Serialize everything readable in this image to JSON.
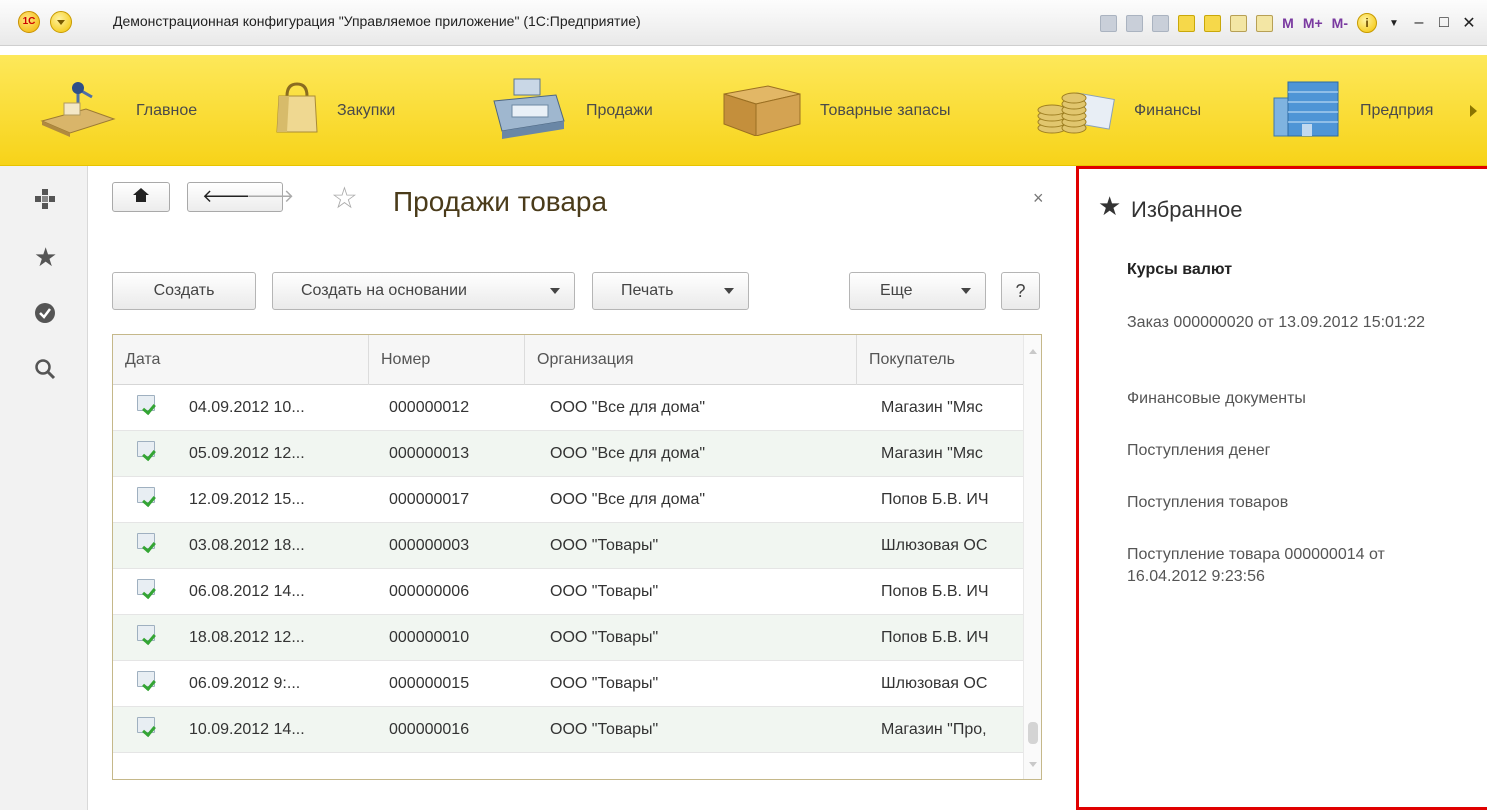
{
  "window": {
    "title": "Демонстрационная конфигурация \"Управляемое приложение\" (1С:Предприятие)",
    "logo_text": "1С",
    "memory_buttons": [
      "M",
      "M+",
      "M-"
    ],
    "info_label": "i",
    "minimize": "–",
    "maximize": "□",
    "close": "✕"
  },
  "sections": [
    {
      "label": "Главное",
      "icon": "desk-lamp-icon"
    },
    {
      "label": "Закупки",
      "icon": "shopping-bag-icon"
    },
    {
      "label": "Продажи",
      "icon": "cash-register-icon"
    },
    {
      "label": "Товарные запасы",
      "icon": "cardboard-box-icon"
    },
    {
      "label": "Финансы",
      "icon": "coins-icon"
    },
    {
      "label": "Предприя",
      "icon": "office-building-icon"
    }
  ],
  "left_panel": [
    "functions-icon",
    "star-icon",
    "history-icon",
    "search-icon"
  ],
  "form": {
    "title": "Продажи товара",
    "close": "×",
    "buttons": {
      "create": "Создать",
      "create_based": "Создать на основании",
      "print": "Печать",
      "more": "Еще",
      "help": "?"
    }
  },
  "table": {
    "columns": [
      "Дата",
      "Номер",
      "Организация",
      "Покупатель"
    ],
    "rows": [
      {
        "date": "04.09.2012 10...",
        "number": "000000012",
        "org": "ООО \"Все для дома\"",
        "buyer": "Магазин \"Мяс"
      },
      {
        "date": "05.09.2012 12...",
        "number": "000000013",
        "org": "ООО \"Все для дома\"",
        "buyer": "Магазин \"Мяс"
      },
      {
        "date": "12.09.2012 15...",
        "number": "000000017",
        "org": "ООО \"Все для дома\"",
        "buyer": "Попов Б.В. ИЧ"
      },
      {
        "date": "03.08.2012 18...",
        "number": "000000003",
        "org": "ООО \"Товары\"",
        "buyer": "Шлюзовая ОС"
      },
      {
        "date": "06.08.2012 14...",
        "number": "000000006",
        "org": "ООО \"Товары\"",
        "buyer": "Попов Б.В. ИЧ"
      },
      {
        "date": "18.08.2012 12...",
        "number": "000000010",
        "org": "ООО \"Товары\"",
        "buyer": "Попов Б.В. ИЧ"
      },
      {
        "date": "06.09.2012 9:...",
        "number": "000000015",
        "org": "ООО \"Товары\"",
        "buyer": "Шлюзовая ОС"
      },
      {
        "date": "10.09.2012 14...",
        "number": "000000016",
        "org": "ООО \"Товары\"",
        "buyer": "Магазин \"Про,"
      }
    ]
  },
  "favorites": {
    "title": "Избранное",
    "items": [
      "Курсы валют",
      "Заказ 000000020 от 13.09.2012 15:01:22",
      "Финансовые документы",
      "Поступления денег",
      "Поступления товаров",
      "Поступление товара 000000014 от 16.04.2012 9:23:56"
    ]
  },
  "colors": {
    "sections_bar": "#f7d319",
    "favorites_border": "#e00000",
    "row_alt": "#f1f6f1"
  }
}
